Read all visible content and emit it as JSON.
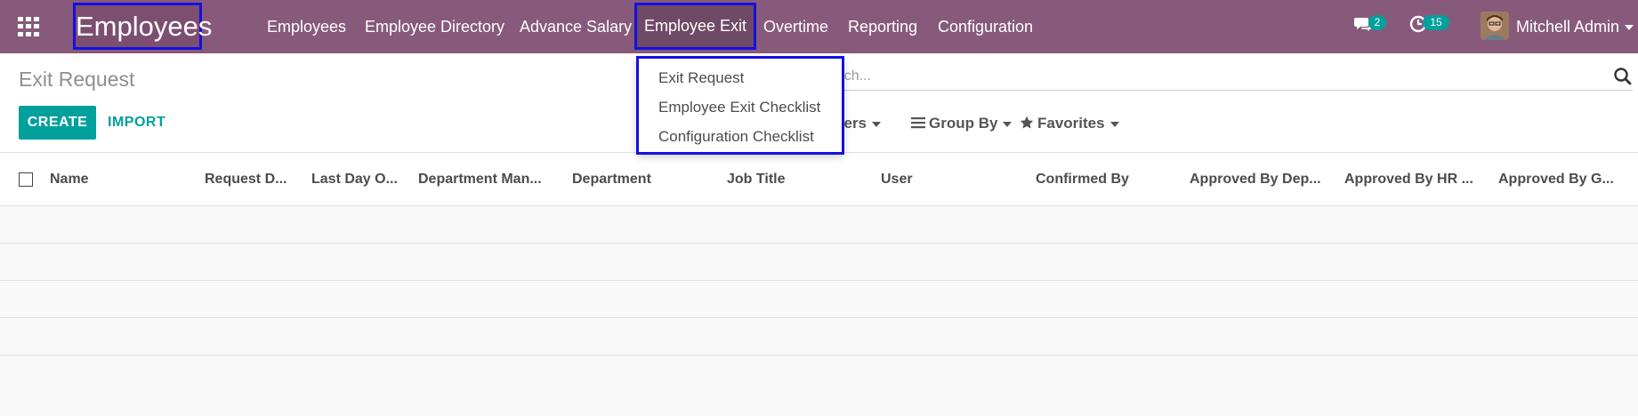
{
  "navbar": {
    "brand": "Employees",
    "menu": [
      "Employees",
      "Employee Directory",
      "Advance Salary",
      "Employee Exit",
      "Overtime",
      "Reporting",
      "Configuration"
    ],
    "messages_count": "2",
    "activities_count": "15",
    "user_name": "Mitchell Admin",
    "bg_color": "#875a7b",
    "badge_color": "#00a09d"
  },
  "dropdown": {
    "items": [
      "Exit Request",
      "Employee Exit Checklist",
      "Configuration Checklist"
    ]
  },
  "control_panel": {
    "title": "Exit Request",
    "create_label": "CREATE",
    "import_label": "IMPORT",
    "search_placeholder": "Search...",
    "filters_label": "Filters",
    "group_by_label": "Group By",
    "favorites_label": "Favorites"
  },
  "list": {
    "columns": [
      "Name",
      "Request D...",
      "Last Day O...",
      "Department Man...",
      "Department",
      "Job Title",
      "User",
      "Confirmed By",
      "Approved By Dep...",
      "Approved By HR ...",
      "Approved By G..."
    ]
  },
  "colors": {
    "accent": "#00a09d",
    "highlight_border": "#1410e0"
  }
}
